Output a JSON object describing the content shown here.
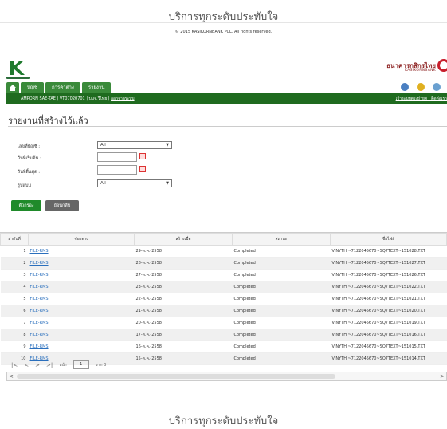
{
  "tagline_top": "บริการทุกระดับประทับใจ",
  "tagline_bottom": "บริการทุกระดับประทับใจ",
  "copyright": "© 2015 KASIKORNBANK PCL. All rights reserved.",
  "bank": {
    "name_th": "ธนาคารกสิกรไทย",
    "name_en": "KASIKORNBANK"
  },
  "menu": {
    "account": "บัญชี",
    "transfer": "การค้าต่าง",
    "report": "รายงาน"
  },
  "user": {
    "name": "AMPORN SAE-TAE",
    "id": "VT07020701",
    "company": "บมจ.วีไทย",
    "logout": "ออกจากระบบ",
    "right_link": "เจ้าระบบตรงถ่ายต | ติดต่อเรา"
  },
  "page_title": "รายงานที่สร้างไว้แล้ว",
  "form": {
    "account_label": "เลขที่บัญชี :",
    "account_value": "All",
    "start_label": "วันที่เริ่มต้น :",
    "end_label": "วันที่สิ้นสุด :",
    "format_label": "รูปแบบ :",
    "format_value": "All"
  },
  "buttons": {
    "filter": "ตัวกรอง",
    "back": "ย้อนกลับ"
  },
  "table": {
    "headers": [
      "ลำดับที่",
      "ช่องทาง",
      "สร้างเมื่อ",
      "สถานะ",
      "ชื่อไฟล์"
    ],
    "rows": [
      [
        "1",
        "FILE-RMS",
        "29-ต.ค.-2558",
        "Completed",
        "VINYTHI~7122045670~SQ7TEXT~151028.TXT"
      ],
      [
        "2",
        "FILE-RMS",
        "28-ต.ค.-2558",
        "Completed",
        "VINYTHI~7122045670~SQ7TEXT~151027.TXT"
      ],
      [
        "3",
        "FILE-RMS",
        "27-ต.ค.-2558",
        "Completed",
        "VINYTHI~7122045670~SQ7TEXT~151026.TXT"
      ],
      [
        "4",
        "FILE-RMS",
        "23-ต.ค.-2558",
        "Completed",
        "VINYTHI~7122045670~SQ7TEXT~151022.TXT"
      ],
      [
        "5",
        "FILE-RMS",
        "22-ต.ค.-2558",
        "Completed",
        "VINYTHI~7122045670~SQ7TEXT~151021.TXT"
      ],
      [
        "6",
        "FILE-RMS",
        "21-ต.ค.-2558",
        "Completed",
        "VINYTHI~7122045670~SQ7TEXT~151020.TXT"
      ],
      [
        "7",
        "FILE-RMS",
        "20-ต.ค.-2558",
        "Completed",
        "VINYTHI~7122045670~SQ7TEXT~151019.TXT"
      ],
      [
        "8",
        "FILE-RMS",
        "17-ต.ค.-2558",
        "Completed",
        "VINYTHI~7122045670~SQ7TEXT~151016.TXT"
      ],
      [
        "9",
        "FILE-RMS",
        "16-ต.ค.-2558",
        "Completed",
        "VINYTHI~7122045670~SQ7TEXT~151015.TXT"
      ],
      [
        "10",
        "FILE-RMS",
        "15-ต.ค.-2558",
        "Completed",
        "VINYTHI~7122045670~SQ7TEXT~151014.TXT"
      ]
    ]
  },
  "pager": {
    "page_label": "หน้า",
    "page_value": "1",
    "of_label": "จาก 3"
  },
  "colors": {
    "brand_green": "#1f6b1f",
    "tab_green": "#3a8a3a",
    "link": "#2a6fbd",
    "bank_red": "#8a1c1c"
  }
}
